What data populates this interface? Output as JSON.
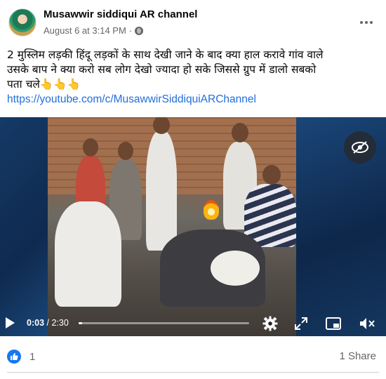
{
  "post": {
    "author": "Musawwir siddiqui AR channel",
    "timestamp": "August 6 at 3:14 PM",
    "separator": "·",
    "privacy_icon": "globe-icon",
    "more_icon": "more-options-icon",
    "text_line1": "2 मुस्लिम लड़की हिंदू लड़कों के साथ देखी जाने के बाद क्या हाल करावे गांव वाले",
    "text_line2": "उसके बाप ने क्या करो सब लोग देखो ज्यादा हो सके जिससे ग्रुप में डालो सबको",
    "text_line3": "पता चले👆👆👆",
    "link": "https://youtube.com/c/MusawwirSiddiquiARChannel"
  },
  "video": {
    "current_time": "0:03",
    "time_separator": " / ",
    "total_time": "2:30",
    "progress": 0.02,
    "icons": [
      "play-icon",
      "settings-icon",
      "fullscreen-expand-icon",
      "picture-in-picture-icon",
      "mute-icon",
      "eye-hidden-icon"
    ]
  },
  "footer": {
    "like_count": "1",
    "shares": "1 Share"
  },
  "colors": {
    "link": "#216fdb",
    "like": "#1877f2",
    "meta": "#65676b"
  }
}
